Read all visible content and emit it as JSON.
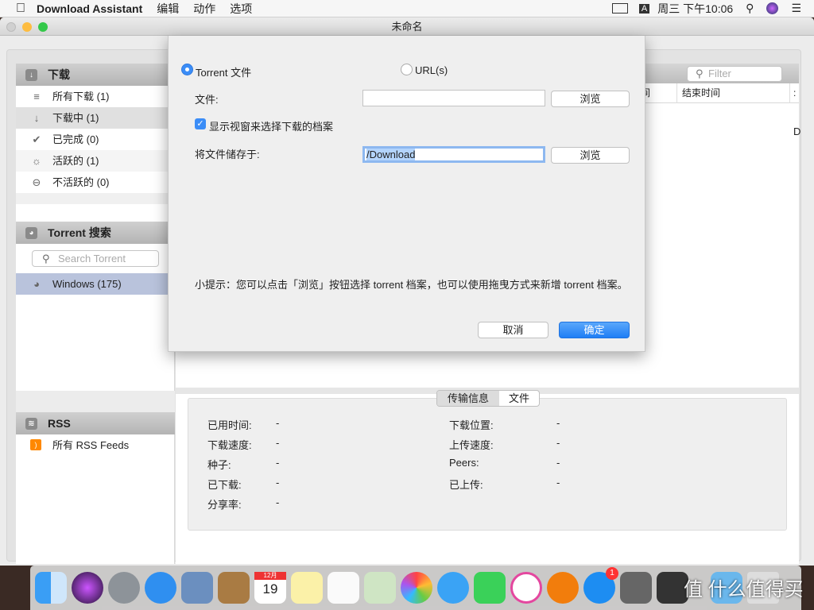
{
  "menubar": {
    "app_name": "Download Assistant",
    "menus": [
      "编辑",
      "动作",
      "选项"
    ],
    "input_method": "A",
    "clock": "周三 下午10:06"
  },
  "window": {
    "title": "未命名"
  },
  "sidebar": {
    "downloads_header": "下载",
    "items": [
      {
        "label": "所有下载 (1)",
        "icon": "list-icon"
      },
      {
        "label": "下载中 (1)",
        "icon": "arrow-down-icon"
      },
      {
        "label": "已完成 (0)",
        "icon": "checkmark-icon"
      },
      {
        "label": "活跃的 (1)",
        "icon": "sun-icon"
      },
      {
        "label": "不活跃的 (0)",
        "icon": "minus-circle-icon"
      }
    ],
    "torrent_header": "Torrent 搜索",
    "search_placeholder": "Search Torrent",
    "torrent_items": [
      {
        "label": "Windows (175)"
      }
    ],
    "rss_header": "RSS",
    "rss_items": [
      {
        "label": "所有 RSS Feeds"
      }
    ]
  },
  "main": {
    "filter_placeholder": "Filter",
    "columns": [
      "间",
      "结束时间",
      ":"
    ],
    "cell_partial": "D"
  },
  "dialog": {
    "radio_torrent": "Torrent 文件",
    "radio_url": "URL(s)",
    "selected": "torrent",
    "file_label": "文件:",
    "file_value": "",
    "browse": "浏览",
    "checkbox_label": "显示视窗来选择下载的档案",
    "checkbox_checked": true,
    "save_label": "将文件储存于:",
    "save_value": "/Download",
    "tip": "小提示：您可以点击「浏览」按钮选择 torrent 档案，也可以使用拖曳方式来新增 torrent 档案。",
    "cancel": "取消",
    "ok": "确定"
  },
  "details": {
    "tabs": [
      "传输信息",
      "文件"
    ],
    "active_tab": "传输信息",
    "left": [
      {
        "label": "已用时间:",
        "value": "-"
      },
      {
        "label": "下载速度:",
        "value": "-"
      },
      {
        "label": "种子:",
        "value": "-"
      },
      {
        "label": "已下载:",
        "value": "-"
      },
      {
        "label": "分享率:",
        "value": "-"
      }
    ],
    "right": [
      {
        "label": "下载位置:",
        "value": "-"
      },
      {
        "label": "上传速度:",
        "value": "-"
      },
      {
        "label": "Peers:",
        "value": "-"
      },
      {
        "label": "已上传:",
        "value": "-"
      }
    ]
  },
  "dock": {
    "apps": [
      "finder",
      "siri",
      "launchpad",
      "safari",
      "mail",
      "contacts",
      "calendar",
      "notes",
      "reminders",
      "maps",
      "photos",
      "messages",
      "facetime",
      "itunes",
      "ibooks",
      "app-store",
      "system-preferences",
      "download-assistant",
      "folder",
      "trash"
    ],
    "calendar_month": "12月",
    "calendar_day": "19",
    "app_store_badge": "1"
  },
  "watermark": "值 什么值得买",
  "colors": {
    "accent": "#3b8df7",
    "selection": "#b9c3dc"
  }
}
